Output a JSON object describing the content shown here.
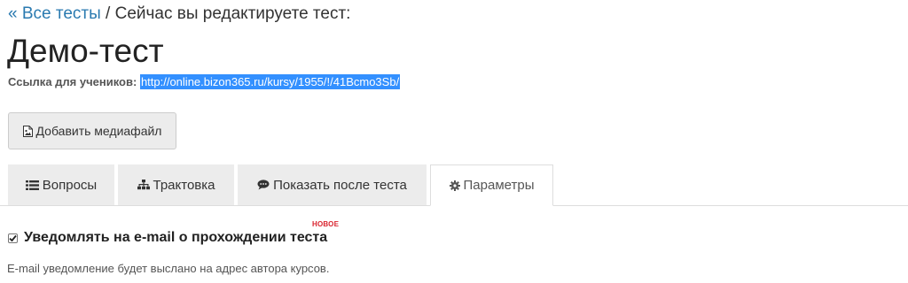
{
  "breadcrumb": {
    "back_link": "« Все тесты",
    "separator": " / ",
    "current_text": "Сейчас вы редактируете тест:"
  },
  "page_title": "Демо-тест",
  "student_link": {
    "label": "Ссылка для учеников:",
    "url": "http://online.bizon365.ru/kursy/1955/!/41Bcmo3Sb/"
  },
  "toolbar": {
    "add_media_label": "Добавить медиафайл",
    "add_media_icon": "image-file-icon"
  },
  "tabs": [
    {
      "label": "Вопросы",
      "icon": "list-icon",
      "active": false
    },
    {
      "label": "Трактовка",
      "icon": "sitemap-icon",
      "active": false
    },
    {
      "label": "Показать после теста",
      "icon": "comment-icon",
      "active": false
    },
    {
      "label": "Параметры",
      "icon": "gear-icon",
      "active": true
    }
  ],
  "settings": {
    "new_badge": "НОВОЕ",
    "email_notify": {
      "checked": true,
      "label": "Уведомлять на e-mail о прохождении теста",
      "help": "E-mail уведомление будет выслано на адрес автора курсов."
    }
  },
  "colors": {
    "link": "#2a7ab0",
    "selection": "#3390ff",
    "badge": "#d9232e",
    "tab_bg": "#ececec"
  }
}
